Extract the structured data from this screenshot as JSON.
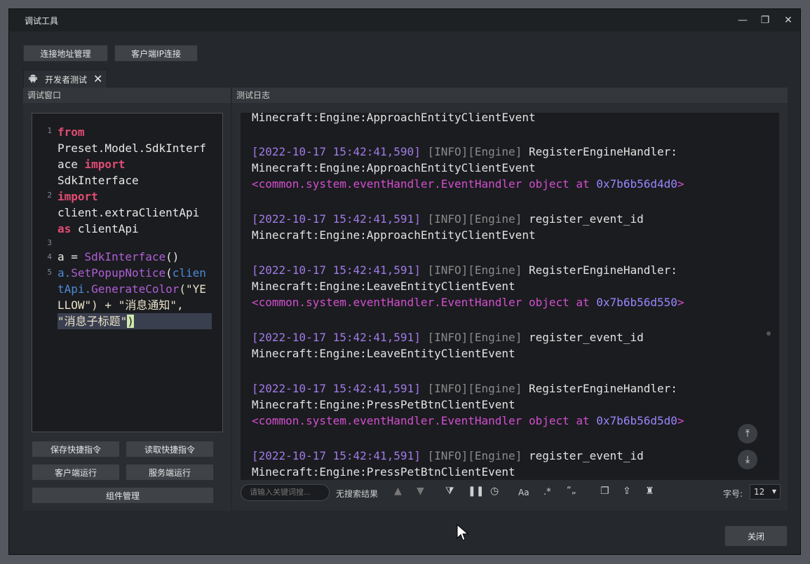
{
  "window": {
    "title": "调试工具"
  },
  "toolbar": {
    "address_btn": "连接地址管理",
    "ip_btn": "客户端IP连接"
  },
  "tab": {
    "label": "开发者测试"
  },
  "left": {
    "header": "调试窗口"
  },
  "right": {
    "header": "测试日志"
  },
  "editor": {
    "line_numbers": [
      "1",
      "2",
      "3",
      "4",
      "5"
    ],
    "code": {
      "l1_kw": "from",
      "l1_a": "Preset.Model.SdkInterf",
      "l1_b": "ace ",
      "l1_kw2": "import",
      "l1_c": "SdkInterface",
      "l2_kw": "import",
      "l2_a": "client.extraClientApi",
      "l2_kw2": "as",
      "l2_b": " clientApi",
      "l4_a": "a = ",
      "l4_fn": "SdkInterface",
      "l4_b": "()",
      "l5_a": "a.",
      "l5_fn": "SetPopupNotice",
      "l5_b": "(",
      "l5_c": "clien",
      "l5_d": "tApi.",
      "l5_fn2": "GenerateColor",
      "l5_e": "(\"YE",
      "l5_f": "LLOW\") + \"消息通知\",",
      "l5_g": "\"消息子标题\"",
      "l5_h": ")"
    }
  },
  "buttons": {
    "save": "保存快捷指令",
    "read": "读取快捷指令",
    "client_run": "客户端运行",
    "server_run": "服务端运行",
    "component": "组件管理"
  },
  "log": {
    "partial_top": "Minecraft:Engine:ApproachEntityClientEvent",
    "entries": [
      {
        "ts": "[2022-10-17 15:42:41,590]",
        "lvl": " [INFO][Engine] ",
        "msg": "RegisterEngineHandler:",
        "msg2": "Minecraft:Engine:ApproachEntityClientEvent",
        "obj": "<common.system.eventHandler.EventHandler object at ",
        "addr": "0x7b6b56d4d0",
        "end": ">"
      },
      {
        "ts": "[2022-10-17 15:42:41,591]",
        "lvl": " [INFO][Engine] ",
        "msg": "register_event_id",
        "msg2": "Minecraft:Engine:ApproachEntityClientEvent"
      },
      {
        "ts": "[2022-10-17 15:42:41,591]",
        "lvl": " [INFO][Engine] ",
        "msg": "RegisterEngineHandler:",
        "msg2": "Minecraft:Engine:LeaveEntityClientEvent",
        "obj": "<common.system.eventHandler.EventHandler object at ",
        "addr": "0x7b6b56d550",
        "end": ">"
      },
      {
        "ts": "[2022-10-17 15:42:41,591]",
        "lvl": " [INFO][Engine] ",
        "msg": "register_event_id",
        "msg2": "Minecraft:Engine:LeaveEntityClientEvent"
      },
      {
        "ts": "[2022-10-17 15:42:41,591]",
        "lvl": " [INFO][Engine] ",
        "msg": "RegisterEngineHandler:",
        "msg2": "Minecraft:Engine:PressPetBtnClientEvent",
        "obj": "<common.system.eventHandler.EventHandler object at ",
        "addr": "0x7b6b56d5d0",
        "end": ">"
      },
      {
        "ts": "[2022-10-17 15:42:41,591]",
        "lvl": " [INFO][Engine] ",
        "msg": "register_event_id",
        "msg2": "Minecraft:Engine:PressPetBtnClientEvent"
      }
    ]
  },
  "search": {
    "placeholder": "请输入关键词搜...",
    "no_result": "无搜索结果"
  },
  "tools": {
    "case_label": "Aa",
    "regex_label": ".*",
    "quote_label": "“„"
  },
  "fontsize": {
    "label": "字号:",
    "value": "12"
  },
  "close_btn": "关闭"
}
